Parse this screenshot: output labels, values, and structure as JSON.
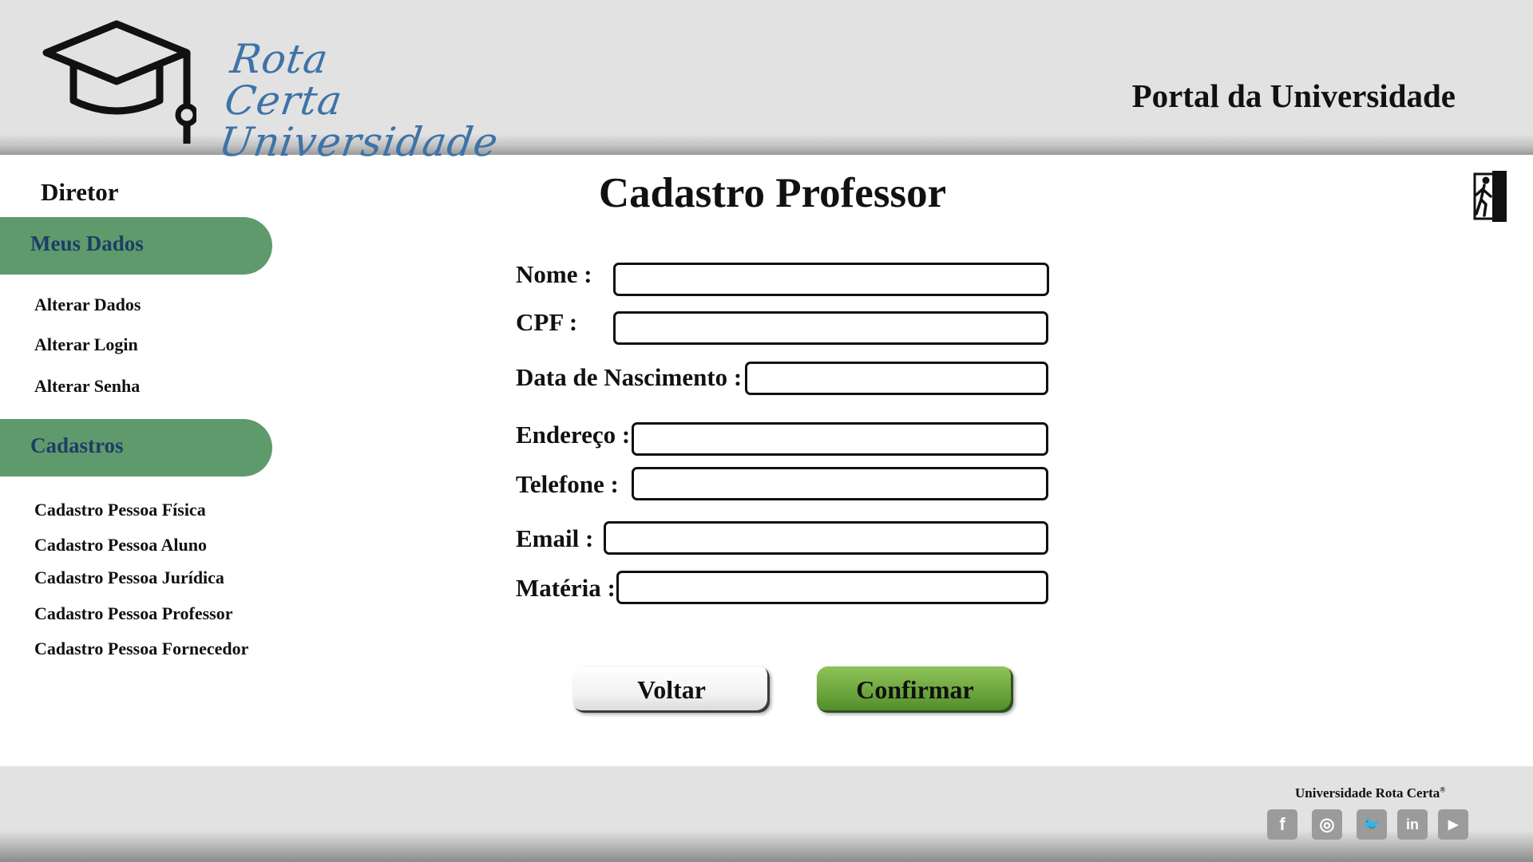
{
  "header": {
    "brand_line1": "Rota Certa",
    "brand_line2": "Universidade",
    "portal_title": "Portal da Universidade"
  },
  "sidebar": {
    "role": "Diretor",
    "sections": [
      {
        "title": "Meus Dados",
        "links": [
          "Alterar Dados",
          "Alterar Login",
          "Alterar Senha"
        ]
      },
      {
        "title": "Cadastros",
        "links": [
          "Cadastro Pessoa Física",
          "Cadastro Pessoa Aluno",
          "Cadastro Pessoa Jurídica",
          "Cadastro Pessoa Professor",
          "Cadastro Pessoa Fornecedor"
        ]
      }
    ]
  },
  "form": {
    "title": "Cadastro Professor",
    "fields": [
      {
        "label": "Nome :",
        "value": ""
      },
      {
        "label": "CPF :",
        "value": ""
      },
      {
        "label": "Data de Nascimento :",
        "value": ""
      },
      {
        "label": "Endereço :",
        "value": ""
      },
      {
        "label": "Telefone :",
        "value": ""
      },
      {
        "label": "Email :",
        "value": ""
      },
      {
        "label": "Matéria :",
        "value": ""
      }
    ],
    "back_label": "Voltar",
    "confirm_label": "Confirmar"
  },
  "footer": {
    "copyright": "Universidade Rota Certa",
    "copyright_mark": "®",
    "social": [
      {
        "icon": "facebook-icon",
        "glyph": "f"
      },
      {
        "icon": "instagram-icon",
        "glyph": "◎"
      },
      {
        "icon": "twitter-icon",
        "glyph": "🐦"
      },
      {
        "icon": "linkedin-icon",
        "glyph": "in"
      },
      {
        "icon": "youtube-icon",
        "glyph": "▶"
      }
    ]
  },
  "colors": {
    "header_bg": "#e2e2e2",
    "sidebar_pill": "#5f9a6d",
    "sidebar_pill_text": "#1c3e66",
    "brand_blue": "#3d73a8",
    "confirm_green": "#6aa33b",
    "social_grey": "#9b9b9b"
  }
}
